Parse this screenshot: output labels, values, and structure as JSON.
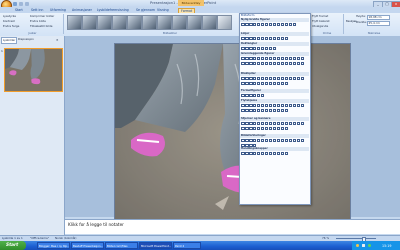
{
  "window": {
    "title": "Presentasjon1 - Microsoft PowerPoint",
    "context_tab_title": "Bildeverktøy",
    "min": "_",
    "max": "□",
    "close": "x"
  },
  "tabs": [
    "Start",
    "Sett inn",
    "Utforming",
    "Animasjoner",
    "Lysbildefremvisning",
    "Se gjennom",
    "Visning",
    "Format"
  ],
  "ribbon": {
    "adjust": [
      "Lysstyrke",
      "Kontrast",
      "Endre farge"
    ],
    "adjust2": [
      "Komprimer bilder",
      "Endre bilde",
      "Tilbakestill bilde"
    ],
    "adjust_label": "Juster",
    "styles_label": "Bildestiler",
    "shapes_header": "Bildeform",
    "arrange": [
      "Flytt fremst",
      "Flytt bakerst",
      "Utvalgsrute"
    ],
    "arrange_label": "Ordne",
    "size": {
      "height_label": "Høyde:",
      "height": "18,98 cm",
      "width_label": "Bredde:",
      "width": "25,4 cm"
    },
    "size_label": "Størrelse",
    "crop": "Beskjær"
  },
  "gallery": {
    "categories": [
      "Nylig brukte figurer",
      "Linjer",
      "Rektangler",
      "Grunnleggende figurer",
      "Blokkpiler",
      "Formelfigurer",
      "Flytskjema",
      "Stjerner og bannere",
      "Bildeforklaringer",
      "Handlingsknapper"
    ]
  },
  "pane": {
    "tab_slides": "Lysbilder",
    "tab_outline": "Disposisjon",
    "slide_number": "1"
  },
  "notes": {
    "placeholder": "Klikk for å legge til notater"
  },
  "status": {
    "slide": "Lysbilde 1 av 1",
    "theme": "\"Office-tema\"",
    "language": "Norsk (bokmål)",
    "zoom": "76 %"
  },
  "taskbar": {
    "start": "Start",
    "tasks": [
      "Blogger: Bee i ny tilp...",
      "Bestuff Presentasjon...",
      "Bilder.com/files",
      "Microsoft PowerPoint...",
      "Paint 2"
    ],
    "clock": "15:19"
  },
  "colors": {
    "accent": "#f29d2a",
    "ribbon": "#d3e3f6",
    "taskbar": "#1b5ed1"
  }
}
